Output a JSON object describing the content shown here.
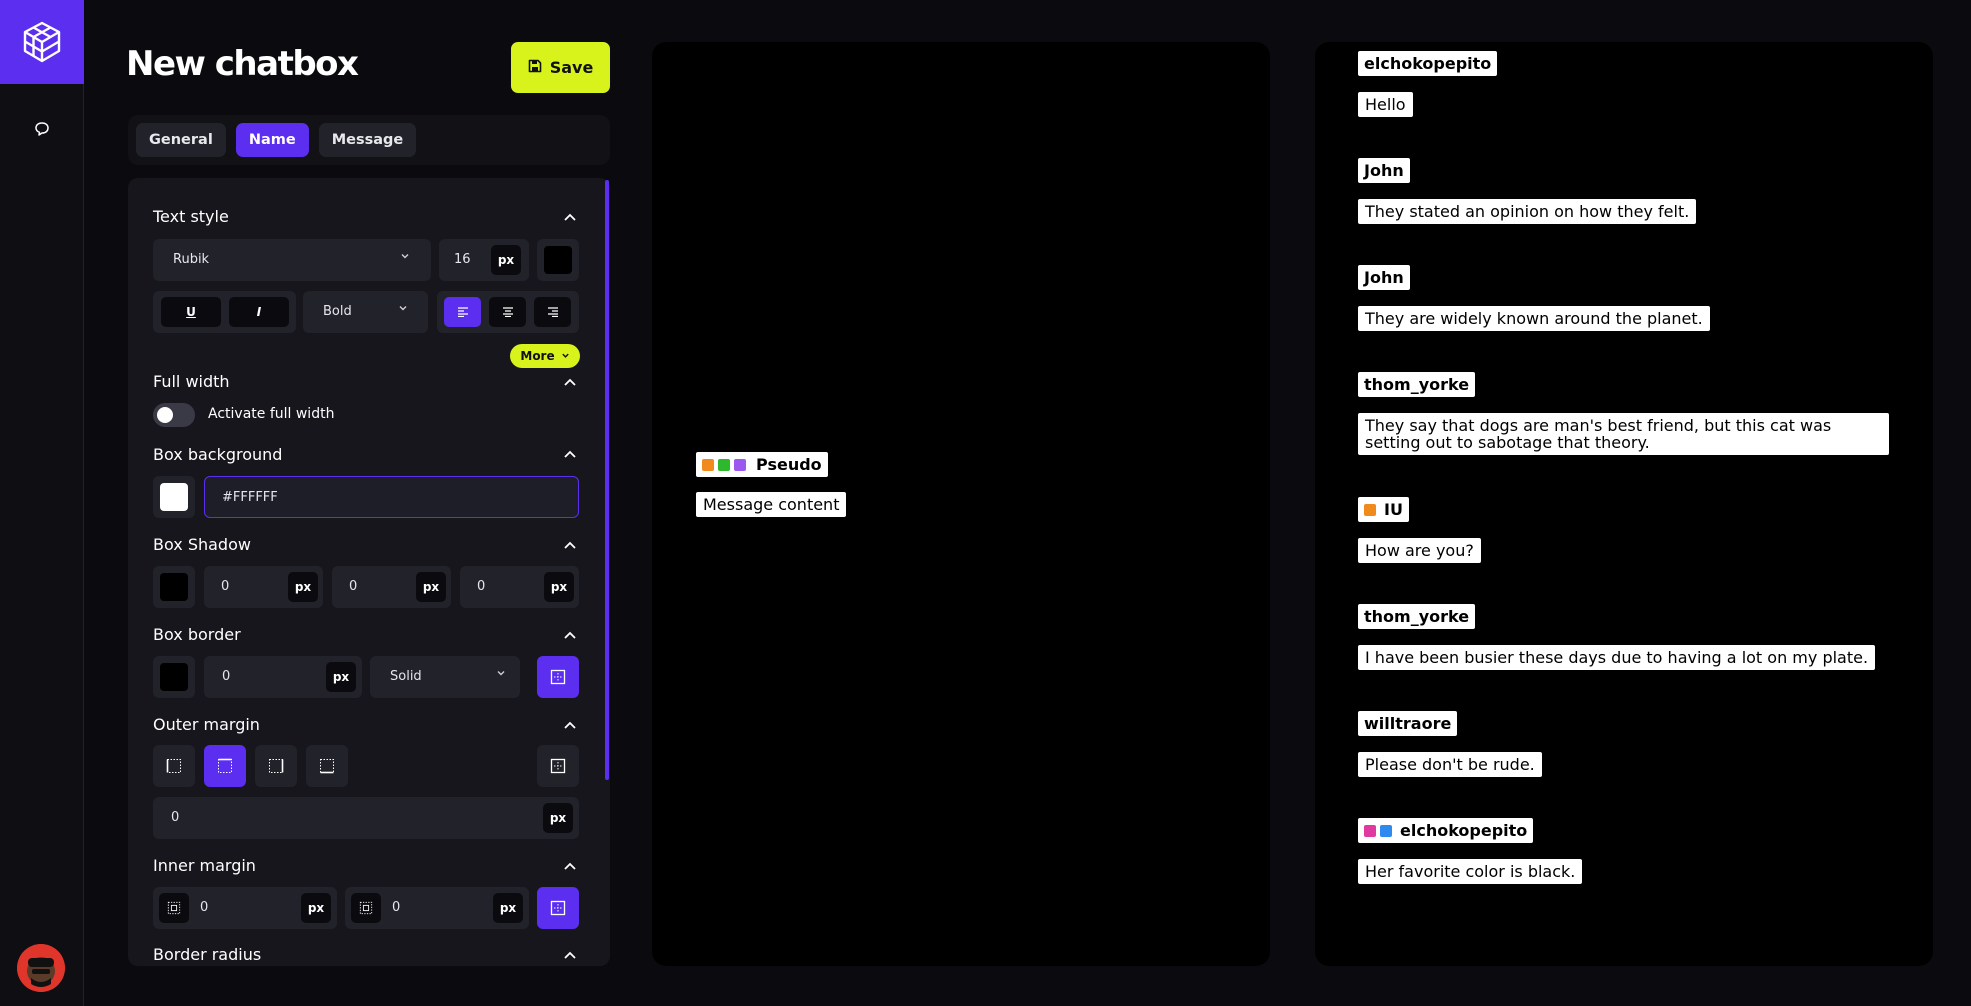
{
  "sidebar": {
    "logo_icon": "cube-logo-icon",
    "nav_icon": "chat-bubble-icon",
    "avatar_icon": "user-avatar"
  },
  "header": {
    "title": "New chatbox",
    "save_label": "Save"
  },
  "tabs": [
    {
      "label": "General",
      "active": false
    },
    {
      "label": "Name",
      "active": true
    },
    {
      "label": "Message",
      "active": false
    }
  ],
  "text_style": {
    "title": "Text style",
    "font": "Rubik",
    "size": "16",
    "unit": "px",
    "underline": "U",
    "italic": "I",
    "weight": "Bold",
    "more_label": "More"
  },
  "full_width": {
    "title": "Full width",
    "toggle_label": "Activate full width",
    "enabled": false
  },
  "box_background": {
    "title": "Box background",
    "color": "#FFFFFF"
  },
  "box_shadow": {
    "title": "Box Shadow",
    "x": "0",
    "y": "0",
    "blur": "0",
    "unit": "px"
  },
  "box_border": {
    "title": "Box border",
    "width": "0",
    "unit": "px",
    "style": "Solid"
  },
  "outer_margin": {
    "title": "Outer margin",
    "value": "0",
    "unit": "px"
  },
  "inner_margin": {
    "title": "Inner margin",
    "horizontal": "0",
    "vertical": "0",
    "unit": "px"
  },
  "border_radius": {
    "title": "Border radius"
  },
  "preview_single": {
    "name": "Pseudo",
    "message": "Message content"
  },
  "chat_messages": [
    {
      "name": "elchokopepito",
      "message": "Hello",
      "badges": []
    },
    {
      "name": "John",
      "message": "They stated an opinion on how they felt.",
      "badges": []
    },
    {
      "name": "John",
      "message": "They are widely known around the planet.",
      "badges": []
    },
    {
      "name": "thom_yorke",
      "message": "They say that dogs are man's best friend, but this cat was setting out to sabotage that theory.",
      "badges": []
    },
    {
      "name": "IU",
      "message": "How are you?",
      "badges": [
        "orange"
      ]
    },
    {
      "name": "thom_yorke",
      "message": "I have been busier these days due to having a lot on my plate.",
      "badges": []
    },
    {
      "name": "willtraore",
      "message": "Please don't be rude.",
      "badges": []
    },
    {
      "name": "elchokopepito",
      "message": "Her favorite color is black.",
      "badges": [
        "pink",
        "blue"
      ]
    }
  ],
  "colors": {
    "accent": "#5b2ef0",
    "highlight": "#d8f31c",
    "badge_orange": "#f08a1c",
    "badge_green": "#2eb82e",
    "badge_purple": "#9b59f0",
    "badge_pink": "#e03aa0",
    "badge_blue": "#2f8af0"
  }
}
